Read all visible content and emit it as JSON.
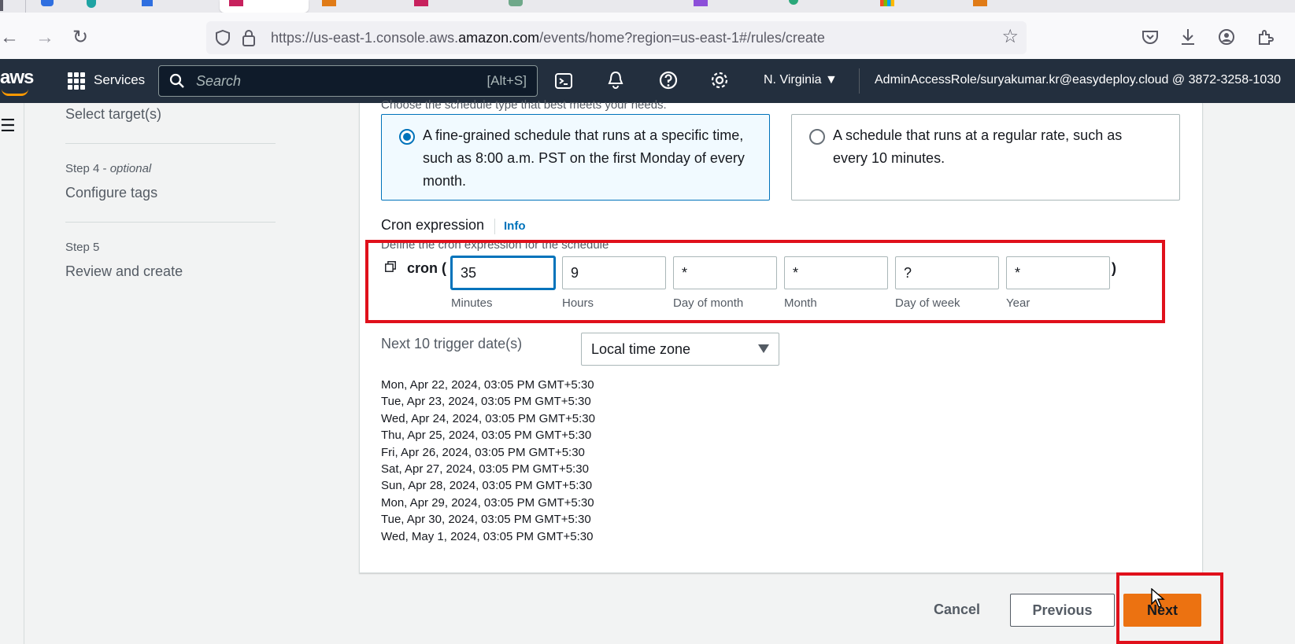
{
  "browser": {
    "url_prefix": "https://us-east-1.console.aws.",
    "url_domain": "amazon.com",
    "url_suffix": "/events/home?region=us-east-1#/rules/create"
  },
  "aws_header": {
    "logo": "aws",
    "services_label": "Services",
    "search_placeholder": "Search",
    "search_shortcut": "[Alt+S]",
    "region": "N. Virginia ▼",
    "account": "AdminAccessRole/suryakumar.kr@easydeploy.cloud @ 3872-3258-1030"
  },
  "steps": [
    {
      "label": "",
      "label_suffix": "",
      "title": "Select target(s)"
    },
    {
      "label": "Step 4 - ",
      "label_suffix": "optional",
      "title": "Configure tags"
    },
    {
      "label": "Step 5",
      "label_suffix": "",
      "title": "Review and create"
    }
  ],
  "schedule": {
    "choose_text": "Choose the schedule type that best meets your needs.",
    "option_cron": "A fine-grained schedule that runs at a specific time, such as 8:00 a.m. PST on the first Monday of every month.",
    "option_rate": "A schedule that runs at a regular rate, such as every 10 minutes.",
    "selected": "cron"
  },
  "cron": {
    "label": "Cron expression",
    "info": "Info",
    "description": "Define the cron expression for the schedule",
    "prefix": "cron (",
    "suffix": ")",
    "fields": [
      {
        "caption": "Minutes",
        "value": "35"
      },
      {
        "caption": "Hours",
        "value": "9"
      },
      {
        "caption": "Day of month",
        "value": "*"
      },
      {
        "caption": "Month",
        "value": "*"
      },
      {
        "caption": "Day of week",
        "value": "?"
      },
      {
        "caption": "Year",
        "value": "*"
      }
    ]
  },
  "triggers": {
    "label": "Next 10 trigger date(s)",
    "timezone": "Local time zone",
    "dates": [
      "Mon, Apr 22, 2024, 03:05 PM GMT+5:30",
      "Tue, Apr 23, 2024, 03:05 PM GMT+5:30",
      "Wed, Apr 24, 2024, 03:05 PM GMT+5:30",
      "Thu, Apr 25, 2024, 03:05 PM GMT+5:30",
      "Fri, Apr 26, 2024, 03:05 PM GMT+5:30",
      "Sat, Apr 27, 2024, 03:05 PM GMT+5:30",
      "Sun, Apr 28, 2024, 03:05 PM GMT+5:30",
      "Mon, Apr 29, 2024, 03:05 PM GMT+5:30",
      "Tue, Apr 30, 2024, 03:05 PM GMT+5:30",
      "Wed, May 1, 2024, 03:05 PM GMT+5:30"
    ]
  },
  "footer": {
    "cancel": "Cancel",
    "previous": "Previous",
    "next": "Next"
  },
  "colors": {
    "aws_header": "#232f3e",
    "accent": "#0073bb",
    "primary_button": "#ec7211",
    "highlight_box": "#e0101b"
  }
}
